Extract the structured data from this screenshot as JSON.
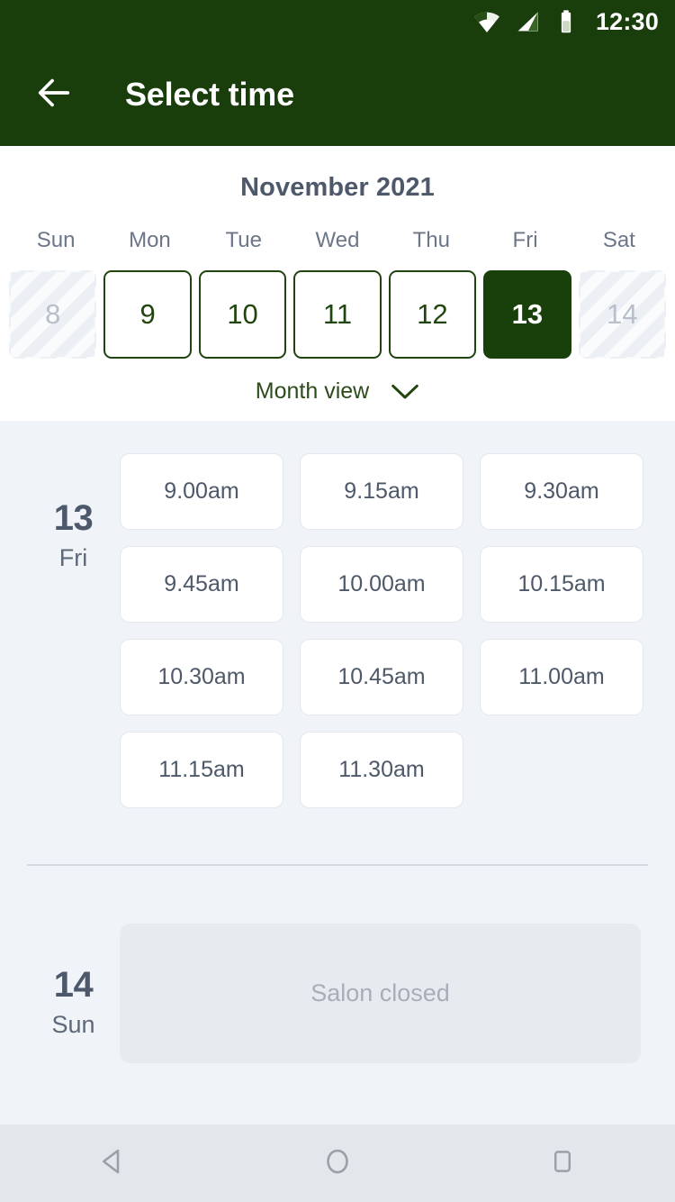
{
  "status_bar": {
    "time": "12:30",
    "icons": [
      "wifi-icon",
      "cellular-signal-icon",
      "battery-icon"
    ]
  },
  "app_bar": {
    "back_icon": "arrow-left-icon",
    "title": "Select time"
  },
  "calendar": {
    "month_title": "November 2021",
    "weekdays": [
      "Sun",
      "Mon",
      "Tue",
      "Wed",
      "Thu",
      "Fri",
      "Sat"
    ],
    "days": [
      {
        "label": "8",
        "state": "disabled"
      },
      {
        "label": "9",
        "state": "available"
      },
      {
        "label": "10",
        "state": "available"
      },
      {
        "label": "11",
        "state": "available"
      },
      {
        "label": "12",
        "state": "available"
      },
      {
        "label": "13",
        "state": "selected"
      },
      {
        "label": "14",
        "state": "disabled"
      }
    ],
    "month_view_label": "Month view",
    "month_view_icon": "chevron-down-icon"
  },
  "slots_section": {
    "day": {
      "number": "13",
      "weekday": "Fri"
    },
    "times": [
      "9.00am",
      "9.15am",
      "9.30am",
      "9.45am",
      "10.00am",
      "10.15am",
      "10.30am",
      "10.45am",
      "11.00am",
      "11.15am",
      "11.30am"
    ]
  },
  "closed_section": {
    "day": {
      "number": "14",
      "weekday": "Sun"
    },
    "message": "Salon closed"
  },
  "nav_bar": {
    "back_icon": "triangle-back-icon",
    "home_icon": "circle-home-icon",
    "recents_icon": "square-recents-icon"
  },
  "colors": {
    "brand_dark_green": "#1a3d0c",
    "selected_day": "#19400b",
    "page_bg": "#f0f3f7",
    "text_slate": "#4d586b",
    "closed_bg": "#e7eaef"
  }
}
